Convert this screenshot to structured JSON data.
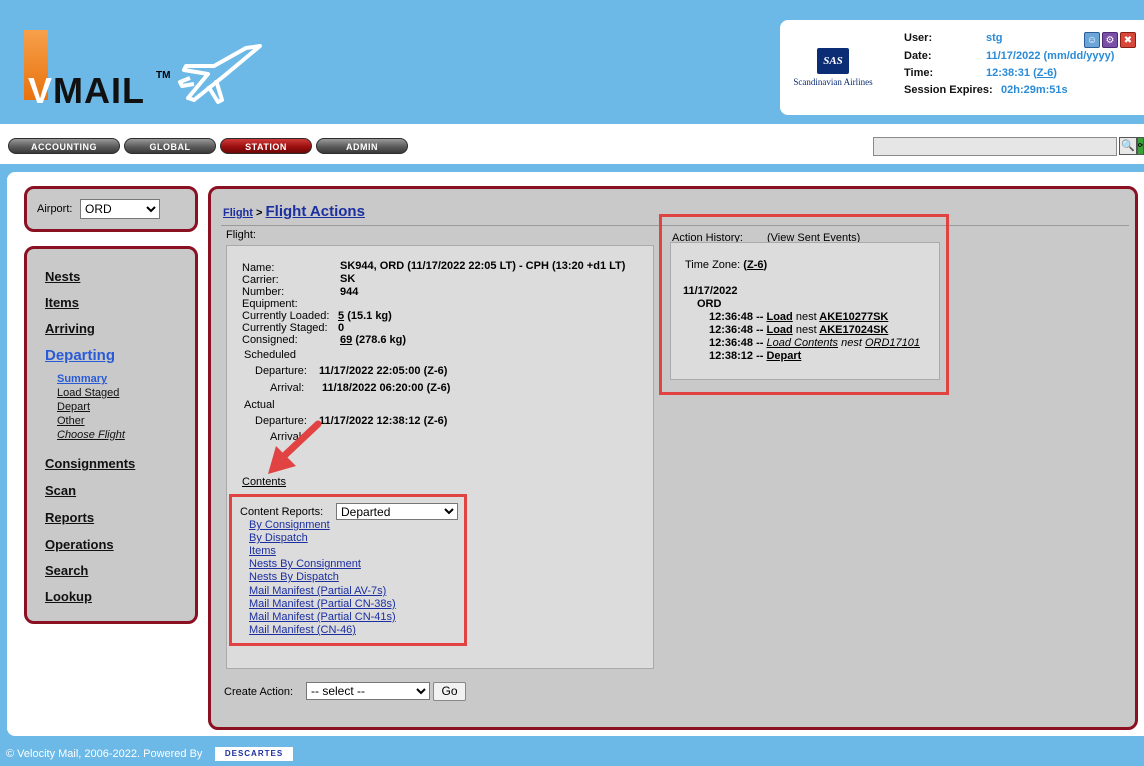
{
  "brand": {
    "logo_text_v": "V",
    "logo_text_rest": "MAIL",
    "trademark": "TM"
  },
  "airline": {
    "name": "Scandinavian Airlines",
    "mark": "SAS"
  },
  "session": {
    "user_label": "User:",
    "user_value": "stg",
    "date_label": "Date:",
    "date_value": "11/17/2022 (mm/dd/yyyy)",
    "time_label": "Time:",
    "time_value": "12:38:31",
    "time_zone": "Z-6",
    "expires_label": "Session Expires:",
    "expires_value": "02h:29m:51s"
  },
  "tabs": [
    {
      "label": "ACCOUNTING",
      "active": false
    },
    {
      "label": "GLOBAL",
      "active": false
    },
    {
      "label": "STATION",
      "active": true
    },
    {
      "label": "ADMIN",
      "active": false
    }
  ],
  "search": {
    "value": ""
  },
  "airport": {
    "label": "Airport:",
    "selected": "ORD"
  },
  "nav": {
    "items": [
      "Nests",
      "Items",
      "Arriving",
      "Departing",
      "Consignments",
      "Scan",
      "Reports",
      "Operations",
      "Search",
      "Lookup"
    ],
    "active": "Departing",
    "sub_items": [
      "Summary",
      "Load Staged",
      "Depart",
      "Other",
      "Choose Flight"
    ],
    "active_sub": "Summary"
  },
  "breadcrumb": {
    "parent": "Flight",
    "separator": ">",
    "current": "Flight Actions"
  },
  "flight": {
    "section_label": "Flight:",
    "name_label": "Name:",
    "name_value": "SK944, ORD (11/17/2022 22:05 LT) - CPH (13:20 +d1 LT)",
    "carrier_label": "Carrier:",
    "carrier_value": "SK",
    "number_label": "Number:",
    "number_value": "944",
    "equipment_label": "Equipment:",
    "loaded_label": "Currently Loaded:",
    "loaded_count": "5",
    "loaded_weight": "(15.1 kg)",
    "staged_label": "Currently Staged:",
    "staged_value": "0",
    "consigned_label": "Consigned:",
    "consigned_count": "69",
    "consigned_weight": "(278.6 kg)",
    "scheduled_label": "Scheduled",
    "sched_departure_label": "Departure:",
    "sched_departure_value": "11/17/2022 22:05:00 (Z-6)",
    "sched_arrival_label": "Arrival:",
    "sched_arrival_value": "11/18/2022 06:20:00 (Z-6)",
    "actual_label": "Actual",
    "actual_departure_label": "Departure:",
    "actual_departure_value": "11/17/2022 12:38:12 (Z-6)",
    "actual_arrival_label": "Arrival:",
    "contents_link": "Contents"
  },
  "content_reports": {
    "label": "Content Reports:",
    "selected": "Departed",
    "links": [
      "By Consignment",
      "By Dispatch",
      "Items",
      "Nests By Consignment",
      "Nests By Dispatch",
      "Mail Manifest (Partial AV-7s)",
      "Mail Manifest (Partial CN-38s)",
      "Mail Manifest (Partial CN-41s)",
      "Mail Manifest (CN-46)"
    ]
  },
  "history": {
    "label": "Action History:",
    "view_link": "(View Sent Events)",
    "timezone_label": "Time Zone:",
    "timezone_value": "Z-6",
    "date": "11/17/2022",
    "station": "ORD",
    "events": [
      {
        "time": "12:36:48 --",
        "action": "Load",
        "text": "nest",
        "ref": "AKE10277SK"
      },
      {
        "time": "12:36:48 --",
        "action": "Load",
        "text": "nest",
        "ref": "AKE17024SK"
      },
      {
        "time": "12:36:48 --",
        "action": "Load Contents",
        "text": "nest",
        "ref": "ORD17101"
      },
      {
        "time": "12:38:12 --",
        "action": "Depart",
        "text": "",
        "ref": ""
      }
    ]
  },
  "create_action": {
    "label": "Create Action:",
    "selected": "-- select --",
    "go_label": "Go"
  },
  "footer": {
    "text": "© Velocity Mail, 2006-2022. Powered By",
    "partner": "DESCARTES"
  }
}
